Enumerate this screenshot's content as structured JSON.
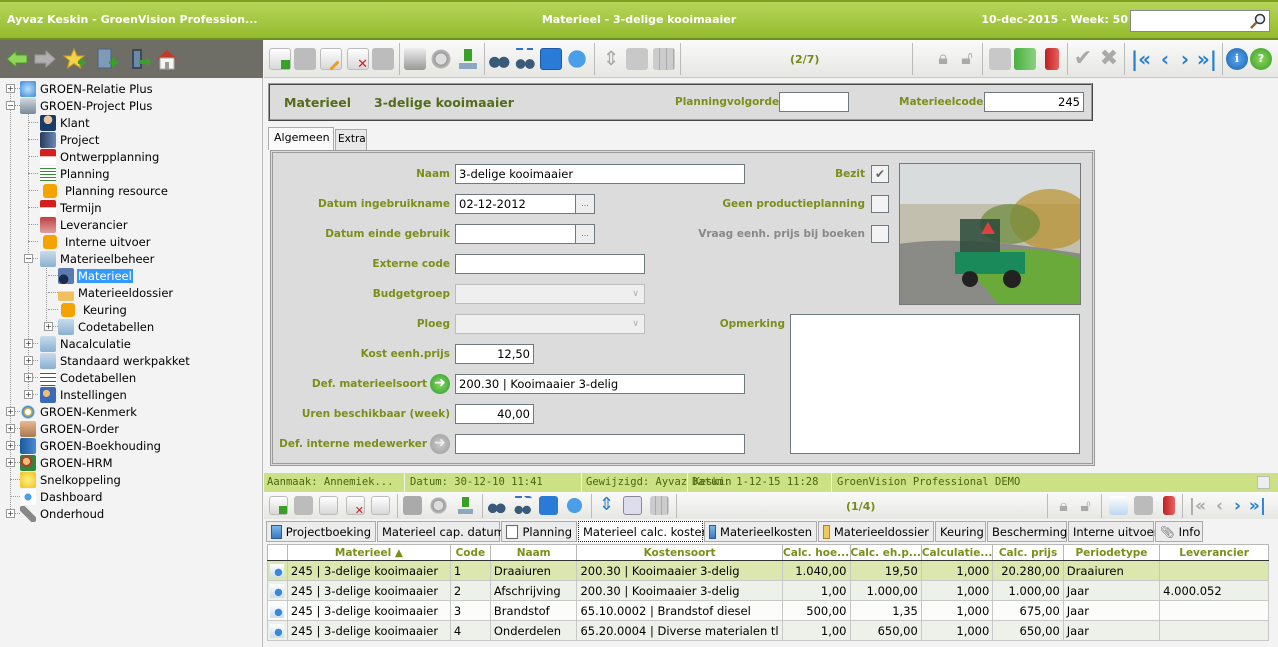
{
  "titlebar": {
    "left": "Ayvaz Keskin - GroenVision Profession...",
    "center": "Materieel - 3-delige kooimaaier",
    "right": "10-dec-2015 - Week: 50",
    "search_value": ""
  },
  "navbar": {
    "icons": [
      "back-arrow-icon",
      "forward-arrow-icon",
      "add-favorite-icon",
      "add-document-icon",
      "logout-icon",
      "home-icon"
    ]
  },
  "sidebar": {
    "items": [
      {
        "label": "GROEN-Relatie Plus",
        "icon": "globe-icon",
        "expander": "+"
      },
      {
        "label": "GROEN-Project Plus",
        "icon": "calculator-icon",
        "expander": "-"
      },
      {
        "label": "Klant",
        "icon": "person-icon"
      },
      {
        "label": "Project",
        "icon": "server-icon"
      },
      {
        "label": "Ontwerpplanning",
        "icon": "calendar-7-icon"
      },
      {
        "label": "Planning",
        "icon": "planning-icon"
      },
      {
        "label": "Planning resource",
        "icon": "orange-square-icon"
      },
      {
        "label": "Termijn",
        "icon": "calendar-12-icon"
      },
      {
        "label": "Leverancier",
        "icon": "supplier-icon"
      },
      {
        "label": "Interne uitvoer",
        "icon": "orange-square-icon"
      },
      {
        "label": "Materieelbeheer",
        "icon": "folder-icon",
        "expander": "-"
      },
      {
        "label": "Materieel",
        "icon": "tractor-icon",
        "selected": true
      },
      {
        "label": "Materieeldossier",
        "icon": "open-folder-icon"
      },
      {
        "label": "Keuring",
        "icon": "orange-square-icon"
      },
      {
        "label": "Codetabellen",
        "icon": "folder-icon",
        "expander": "+"
      },
      {
        "label": "Nacalculatie",
        "icon": "folder-icon",
        "expander": "+"
      },
      {
        "label": "Standaard werkpakket",
        "icon": "folder-icon",
        "expander": "+"
      },
      {
        "label": "Codetabellen",
        "icon": "list-icon",
        "expander": "+"
      },
      {
        "label": "Instellingen",
        "icon": "users-icon",
        "expander": "+"
      },
      {
        "label": "GROEN-Kenmerk",
        "icon": "gear-blue-icon",
        "expander": "+"
      },
      {
        "label": "GROEN-Order",
        "icon": "handshake-icon",
        "expander": "+"
      },
      {
        "label": "GROEN-Boekhouding",
        "icon": "ledger-icon",
        "expander": "+"
      },
      {
        "label": "GROEN-HRM",
        "icon": "people-icon",
        "expander": "+"
      },
      {
        "label": "Snelkoppeling",
        "icon": "star-icon"
      },
      {
        "label": "Dashboard",
        "icon": "dashboard-icon"
      },
      {
        "label": "Onderhoud",
        "icon": "wrench-icon",
        "expander": "+"
      }
    ]
  },
  "toolbar": {
    "counter": "(2/7)"
  },
  "header": {
    "type_label": "Materieel",
    "title": "3-delige kooimaaier",
    "planningvolgorde_label": "Planningvolgorde",
    "planningvolgorde_value": "",
    "materieelcode_label": "Materieelcode",
    "materieelcode_value": "245"
  },
  "tabs": [
    {
      "label": "Algemeen",
      "active": true
    },
    {
      "label": "Extra",
      "active": false
    }
  ],
  "form": {
    "naam_label": "Naam",
    "naam_value": "3-delige kooimaaier",
    "datum_ingebruikname_label": "Datum ingebruikname",
    "datum_ingebruikname_value": "02-12-2012",
    "datum_einde_label": "Datum einde gebruik",
    "datum_einde_value": "",
    "externe_code_label": "Externe code",
    "externe_code_value": "",
    "budgetgroep_label": "Budgetgroep",
    "budgetgroep_value": "",
    "ploeg_label": "Ploeg",
    "ploeg_value": "",
    "kost_label": "Kost eenh.prijs",
    "kost_value": "12,50",
    "materieelsoort_label": "Def. materieelsoort",
    "materieelsoort_value": "200.30 | Kooimaaier 3-delig",
    "uren_label": "Uren beschikbaar (week)",
    "uren_value": "40,00",
    "medewerker_label": "Def. interne medewerker",
    "medewerker_value": "",
    "bezit_label": "Bezit",
    "bezit_checked": true,
    "geen_productie_label": "Geen productieplanning",
    "geen_productie_checked": false,
    "vraag_prijs_label": "Vraag eenh. prijs bij boeken",
    "vraag_prijs_checked": false,
    "opmerking_label": "Opmerking",
    "opmerking_value": "",
    "datepicker_label": "..."
  },
  "statusbar": {
    "aanmaak": "Aanmaak: Annemiek...",
    "datum1": "Datum: 30-12-10 11:41",
    "gewijzigd": "Gewijzigd: Ayvaz Keskin",
    "datum2": "Datum: 1-12-15 11:28",
    "product": "GroenVision Professional DEMO"
  },
  "toolbar2": {
    "counter": "(1/4)"
  },
  "subtabs": [
    {
      "label": "Projectboeking",
      "icon": "grid-add-icon"
    },
    {
      "label": "Materieel cap. datum"
    },
    {
      "label": "Planning",
      "icon": "planning-icon"
    },
    {
      "label": "Materieel calc. kosten",
      "active": true
    },
    {
      "label": "Materieelkosten",
      "icon": "grid-add-icon"
    },
    {
      "label": "Materieeldossier",
      "icon": "open-folder-icon"
    },
    {
      "label": "Keuring"
    },
    {
      "label": "Bescherming"
    },
    {
      "label": "Interne uitvoer"
    },
    {
      "label": "Info",
      "icon": "paperclip-icon"
    }
  ],
  "grid": {
    "columns": [
      "",
      "Materieel ▲",
      "Code",
      "Naam",
      "Kostensoort",
      "Calc. hoe...",
      "Calc. eh.p...",
      "Calculatie...",
      "Calc. prijs",
      "Periodetype",
      "Leverancier"
    ],
    "rows": [
      {
        "materieel": "245 | 3-delige kooimaaier",
        "code": "1",
        "naam": "Draaiuren",
        "kostensoort": "200.30 | Kooimaaier 3-delig",
        "calc_hoe": "1.040,00",
        "calc_ehp": "19,50",
        "calculatie": "1,000",
        "calc_prijs": "20.280,00",
        "periodetype": "Draaiuren",
        "leverancier": ""
      },
      {
        "materieel": "245 | 3-delige kooimaaier",
        "code": "2",
        "naam": "Afschrijving",
        "kostensoort": "200.30 | Kooimaaier 3-delig",
        "calc_hoe": "1,00",
        "calc_ehp": "1.000,00",
        "calculatie": "1,000",
        "calc_prijs": "1.000,00",
        "periodetype": "Jaar",
        "leverancier": "4.000.052"
      },
      {
        "materieel": "245 | 3-delige kooimaaier",
        "code": "3",
        "naam": "Brandstof",
        "kostensoort": "65.10.0002 | Brandstof diesel",
        "calc_hoe": "500,00",
        "calc_ehp": "1,35",
        "calculatie": "1,000",
        "calc_prijs": "675,00",
        "periodetype": "Jaar",
        "leverancier": ""
      },
      {
        "materieel": "245 | 3-delige kooimaaier",
        "code": "4",
        "naam": "Onderdelen",
        "kostensoort": "65.20.0004 | Diverse materialen tl",
        "calc_hoe": "1,00",
        "calc_ehp": "650,00",
        "calculatie": "1,000",
        "calc_prijs": "650,00",
        "periodetype": "Jaar",
        "leverancier": ""
      }
    ]
  },
  "colors": {
    "brand_green": "#94bb2e",
    "label_green": "#7a8f18",
    "status_green": "#cce085",
    "selection_blue": "#3399ff",
    "selected_row": "#dae8b0"
  }
}
